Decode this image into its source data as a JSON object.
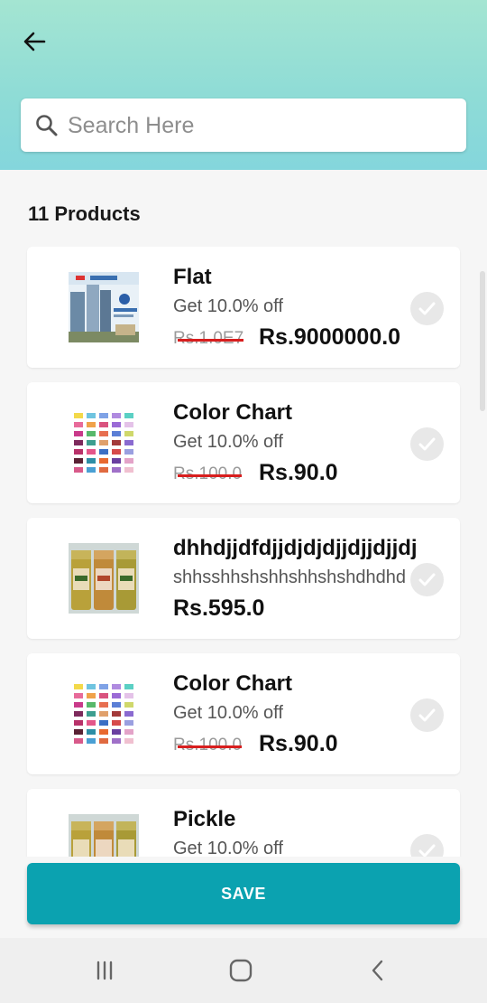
{
  "header": {
    "back_icon": "arrow-left-icon"
  },
  "search": {
    "placeholder": "Search Here",
    "icon": "search-icon"
  },
  "products_count": "11 Products",
  "products": [
    {
      "name": "Flat",
      "subtitle": "Get 10.0% off",
      "old_price": "Rs.1.0E7",
      "price": "Rs.9000000.0",
      "image": "building-poster-image"
    },
    {
      "name": "Color Chart",
      "subtitle": "Get 10.0% off",
      "old_price": "Rs.100.0",
      "price": "Rs.90.0",
      "image": "color-swatch-image"
    },
    {
      "name": "dhhdjjdfdjjdjdjdjjdjjdjjdj",
      "subtitle": "shhsshhshshhshhshshdhdhd",
      "price": "Rs.595.0",
      "image": "pickle-jars-image"
    },
    {
      "name": "Color Chart",
      "subtitle": "Get 10.0% off",
      "old_price": "Rs.100.0",
      "price": "Rs.90.0",
      "image": "color-swatch-image"
    },
    {
      "name": "Pickle",
      "subtitle": "Get 10.0% off",
      "image": "pickle-jars-image"
    }
  ],
  "save_label": "SAVE",
  "colors": {
    "header_top": "#a4e5d2",
    "header_bottom": "#84d6dc",
    "accent": "#0ba2b0",
    "strike": "#d81e1e"
  },
  "navbar": {
    "icons": [
      "recent-apps-icon",
      "home-icon",
      "back-icon"
    ]
  }
}
